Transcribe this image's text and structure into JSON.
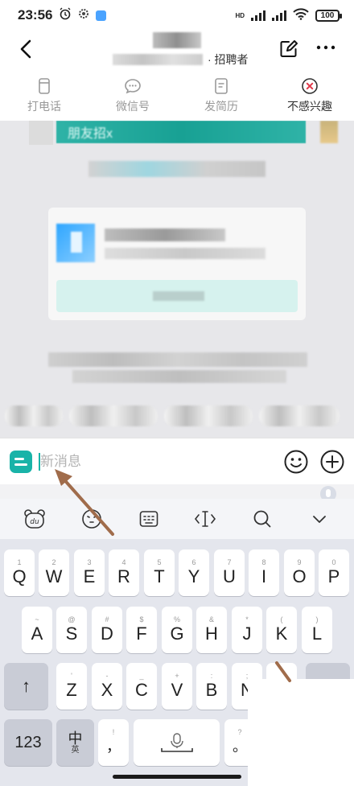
{
  "status_bar": {
    "time": "23:56",
    "network_label": "HD",
    "battery": "100"
  },
  "header": {
    "role_label": "· 招聘者"
  },
  "actions": [
    {
      "label": "打电话",
      "icon": "phone-icon"
    },
    {
      "label": "微信号",
      "icon": "wechat-icon"
    },
    {
      "label": "发简历",
      "icon": "resume-icon"
    },
    {
      "label": "不感兴趣",
      "icon": "not-interested-icon"
    }
  ],
  "chat": {
    "banner_text": "朋友招x"
  },
  "input": {
    "placeholder": "新消息"
  },
  "keyboard": {
    "row1": [
      {
        "hint": "1",
        "main": "Q"
      },
      {
        "hint": "2",
        "main": "W"
      },
      {
        "hint": "3",
        "main": "E"
      },
      {
        "hint": "4",
        "main": "R"
      },
      {
        "hint": "5",
        "main": "T"
      },
      {
        "hint": "6",
        "main": "Y"
      },
      {
        "hint": "7",
        "main": "U"
      },
      {
        "hint": "8",
        "main": "I"
      },
      {
        "hint": "9",
        "main": "O"
      },
      {
        "hint": "0",
        "main": "P"
      }
    ],
    "row2": [
      {
        "hint": "~",
        "main": "A"
      },
      {
        "hint": "@",
        "main": "S"
      },
      {
        "hint": "#",
        "main": "D"
      },
      {
        "hint": "$",
        "main": "F"
      },
      {
        "hint": "%",
        "main": "G"
      },
      {
        "hint": "&",
        "main": "H"
      },
      {
        "hint": "*",
        "main": "J"
      },
      {
        "hint": "(",
        "main": "K"
      },
      {
        "hint": ")",
        "main": "L"
      }
    ],
    "row3": [
      {
        "hint": "'",
        "main": "Z"
      },
      {
        "hint": "-",
        "main": "X"
      },
      {
        "hint": "_",
        "main": "C"
      },
      {
        "hint": "+",
        "main": "V"
      },
      {
        "hint": ":",
        "main": "B"
      },
      {
        "hint": ";",
        "main": "N"
      }
    ],
    "shift_label": "↑",
    "num_label": "123",
    "lang_main": "中",
    "lang_sub": "英",
    "comma_hint": "!",
    "comma_main": "，",
    "period_hint": "?",
    "period_main": "。"
  },
  "colors": {
    "accent": "#19b3a8",
    "arrow": "#a06c4b"
  }
}
